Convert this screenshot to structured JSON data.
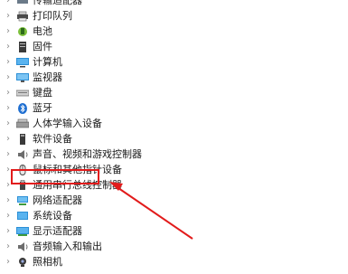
{
  "tree": {
    "items": [
      {
        "label": "传输适配器",
        "icon": "adapter-icon",
        "chevron": "›"
      },
      {
        "label": "打印队列",
        "icon": "printer-queue-icon",
        "chevron": "›"
      },
      {
        "label": "电池",
        "icon": "battery-icon",
        "chevron": "›"
      },
      {
        "label": "固件",
        "icon": "firmware-icon",
        "chevron": "›"
      },
      {
        "label": "计算机",
        "icon": "computer-icon",
        "chevron": "›"
      },
      {
        "label": "监视器",
        "icon": "monitor-icon",
        "chevron": "›"
      },
      {
        "label": "键盘",
        "icon": "keyboard-icon",
        "chevron": "›"
      },
      {
        "label": "蓝牙",
        "icon": "bluetooth-icon",
        "chevron": "›"
      },
      {
        "label": "人体学输入设备",
        "icon": "hid-icon",
        "chevron": "›"
      },
      {
        "label": "软件设备",
        "icon": "software-device-icon",
        "chevron": "›"
      },
      {
        "label": "声音、视频和游戏控制器",
        "icon": "speaker-icon",
        "chevron": "›"
      },
      {
        "label": "鼠标和其他指针设备",
        "icon": "mouse-icon",
        "chevron": "›"
      },
      {
        "label": "通用串行总线控制器",
        "icon": "usb-icon",
        "chevron": "›"
      },
      {
        "label": "网络适配器",
        "icon": "network-adapter-icon",
        "chevron": "›"
      },
      {
        "label": "系统设备",
        "icon": "system-device-icon",
        "chevron": "›"
      },
      {
        "label": "显示适配器",
        "icon": "display-adapter-icon",
        "chevron": "›"
      },
      {
        "label": "音频输入和输出",
        "icon": "audio-io-icon",
        "chevron": "›"
      },
      {
        "label": "照相机",
        "icon": "camera-icon",
        "chevron": "›"
      }
    ]
  },
  "annotation": {
    "highlight_color": "#e21b1b",
    "highlighted_item": "网络适配器"
  }
}
